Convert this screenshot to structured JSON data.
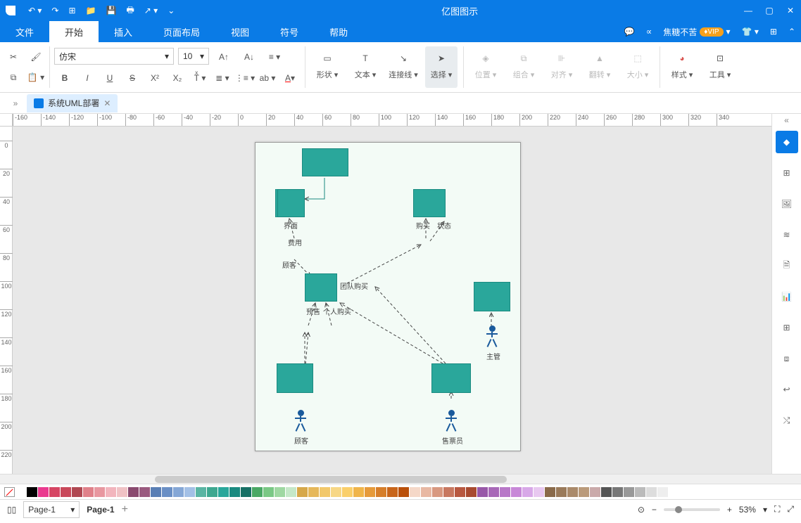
{
  "app_title": "亿图图示",
  "user_name": "焦糖不苦",
  "vip_label": "VIP",
  "menu": {
    "file": "文件",
    "start": "开始",
    "insert": "插入",
    "layout": "页面布局",
    "view": "视图",
    "symbol": "符号",
    "help": "帮助"
  },
  "font": {
    "family": "仿宋",
    "size": "10"
  },
  "tools": {
    "shape": "形状",
    "text": "文本",
    "connector": "连接线",
    "select": "选择",
    "position": "位置",
    "combine": "组合",
    "align": "对齐",
    "rotate": "翻转",
    "size": "大小",
    "style": "样式",
    "utils": "工具"
  },
  "doc_tab": "系统UML部署",
  "nodes": {
    "n1_label": "界面",
    "n2_label": "购买",
    "n3_label": "状态",
    "n4_label": "费用",
    "n5_label": "顾客",
    "n6_label": "团队购买",
    "n7_label": "预售",
    "n8_label": "个人购买",
    "actor1": "主管",
    "actor2": "顾客",
    "actor3": "售票员"
  },
  "ruler_h": [
    "-160",
    "-140",
    "-120",
    "-100",
    "-80",
    "-60",
    "-40",
    "-20",
    "0",
    "20",
    "40",
    "60",
    "80",
    "100",
    "120",
    "140",
    "160",
    "180",
    "200",
    "220",
    "240",
    "260",
    "280",
    "300",
    "320",
    "340"
  ],
  "ruler_v": [
    "0",
    "20",
    "40",
    "60",
    "80",
    "100",
    "120",
    "140",
    "160",
    "180",
    "200",
    "220"
  ],
  "palette": [
    "#ffffff",
    "#000000",
    "#ea3a8f",
    "#d64563",
    "#c9485a",
    "#b04852",
    "#e0818a",
    "#e897a0",
    "#f2b5bd",
    "#f0c2c5",
    "#8a4a6f",
    "#9a5a7f",
    "#5a7fb5",
    "#6a8fc5",
    "#85a7d6",
    "#a3c0e6",
    "#5ab5a3",
    "#3ea890",
    "#2aa79b",
    "#1a8a80",
    "#177065",
    "#4aa865",
    "#7ac885",
    "#9fd8a2",
    "#c5e8c8",
    "#d6a84a",
    "#e6b85a",
    "#f2c86a",
    "#f7d785",
    "#facf6a",
    "#f0b54a",
    "#e69a3a",
    "#d67e2a",
    "#c8651a",
    "#ba500a",
    "#f5d8c8",
    "#e8b8a3",
    "#d89880",
    "#c87860",
    "#b85840",
    "#a84a30",
    "#9858a8",
    "#a868b8",
    "#b878c8",
    "#c888d8",
    "#d8a8e8",
    "#e8c8f0",
    "#8a6a4a",
    "#9a7a5a",
    "#aa8a6a",
    "#ba9a7a",
    "#caaaaa",
    "#555555",
    "#777777",
    "#999999",
    "#bbbbbb",
    "#dddddd",
    "#eeeeee"
  ],
  "page_label": "Page-1",
  "zoom": "53%"
}
